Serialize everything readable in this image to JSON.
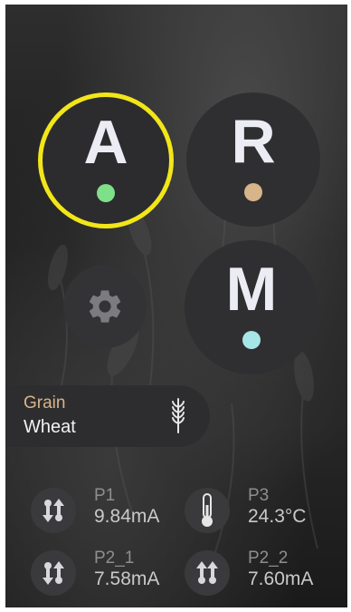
{
  "modes": [
    {
      "letter": "A",
      "name": "mode-a",
      "selected": true,
      "dot_color": "#7fe08a"
    },
    {
      "letter": "R",
      "name": "mode-r",
      "selected": false,
      "dot_color": "#d7b489"
    },
    {
      "letter": "M",
      "name": "mode-m",
      "selected": false,
      "dot_color": "#a6e6e6"
    }
  ],
  "colors": {
    "selection_ring": "#f2e619",
    "button_bg": "#2f2f31",
    "grain_label": "#d7b489"
  },
  "grain": {
    "label": "Grain",
    "value": "Wheat",
    "icon": "wheat-icon"
  },
  "sensors": [
    {
      "name": "P1",
      "value": "9.84mA",
      "icon": "pressure-arrows-icon"
    },
    {
      "name": "P3",
      "value": "24.3°C",
      "icon": "thermometer-icon"
    },
    {
      "name": "P2_1",
      "value": "7.58mA",
      "icon": "pressure-arrows-icon"
    },
    {
      "name": "P2_2",
      "value": "7.60mA",
      "icon": "pressure-arrows-icon"
    }
  ],
  "settings": {
    "icon": "gear-icon"
  }
}
